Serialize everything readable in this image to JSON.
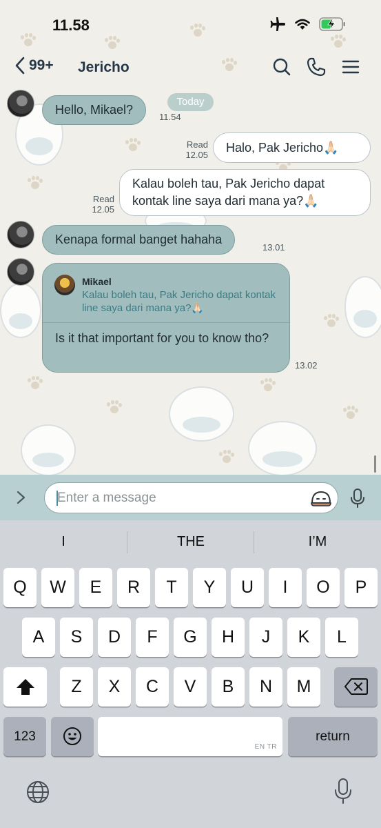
{
  "status_bar": {
    "time": "11.58"
  },
  "header": {
    "back_count": "99+",
    "title": "Jericho"
  },
  "chat": {
    "date_divider": "Today",
    "messages": [
      {
        "text": "Hello, Mikael?",
        "time": "11.54"
      },
      {
        "text": "Halo, Pak Jericho🙏🏻",
        "read": "Read",
        "time": "12.05"
      },
      {
        "text": "Kalau boleh tau, Pak Jericho dapat kontak line saya dari mana ya?🙏🏻",
        "read": "Read",
        "time": "12.05"
      },
      {
        "text": "Kenapa formal banget hahaha",
        "time": "13.01"
      },
      {
        "reply_to": {
          "name": "Mikael",
          "text": "Kalau boleh tau, Pak Jericho dapat kontak line saya dari mana ya?🙏🏻"
        },
        "text": "Is it that important for you to know tho?",
        "time": "13.02"
      }
    ]
  },
  "input": {
    "placeholder": "Enter a message"
  },
  "keyboard": {
    "suggestions": [
      "I",
      "THE",
      "I’M"
    ],
    "row1": [
      "Q",
      "W",
      "E",
      "R",
      "T",
      "Y",
      "U",
      "I",
      "O",
      "P"
    ],
    "row2": [
      "A",
      "S",
      "D",
      "F",
      "G",
      "H",
      "J",
      "K",
      "L"
    ],
    "row3": [
      "Z",
      "X",
      "C",
      "V",
      "B",
      "N",
      "M"
    ],
    "numbers_key": "123",
    "space_language": "EN TR",
    "return_key": "return"
  },
  "icons": {
    "airplane": "airplane-icon",
    "wifi": "wifi-icon",
    "battery": "battery-charging-icon",
    "back": "chevron-left-icon",
    "search": "search-icon",
    "call": "phone-icon",
    "menu": "hamburger-menu-icon",
    "expand": "chevron-right-icon",
    "sticker": "sticker-icon",
    "mic": "microphone-icon",
    "shift": "shift-icon",
    "delete": "backspace-icon",
    "emoji": "emoji-icon",
    "globe": "globe-icon"
  },
  "colors": {
    "incoming_bubble": "#a1bdbd",
    "outgoing_bubble": "#ffffff",
    "input_bar": "#b9d0d2",
    "quote_text": "#3b7c84",
    "keyboard_bg": "#d1d4d9"
  }
}
